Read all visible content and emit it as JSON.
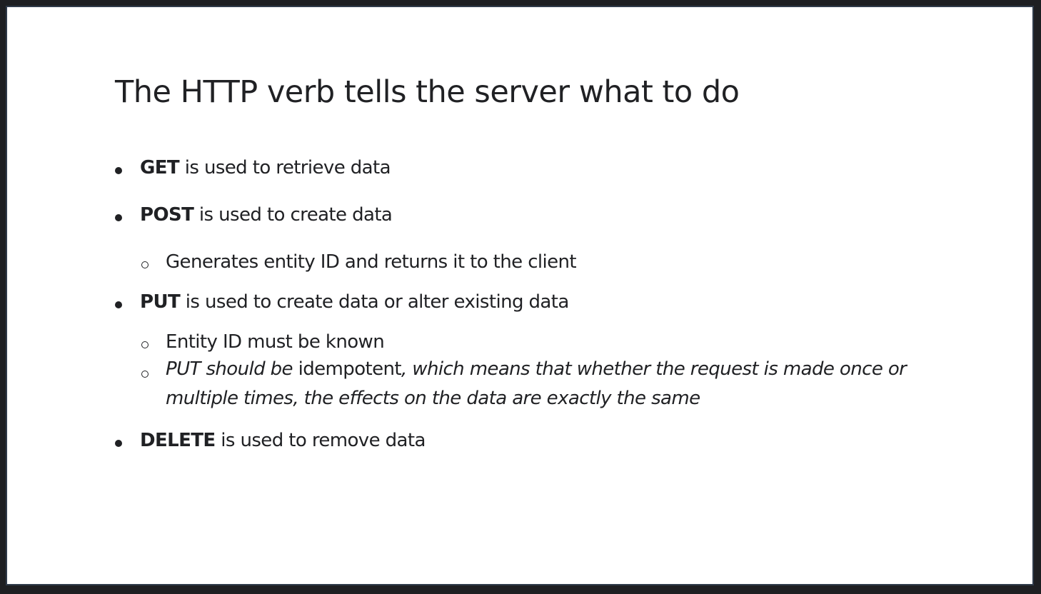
{
  "slide": {
    "title": "The HTTP verb tells the server what to do",
    "bullets": {
      "get": {
        "verb": "GET",
        "text": " is used to retrieve data"
      },
      "post": {
        "verb": "POST",
        "text": " is used to create data",
        "sub": "Generates entity ID and returns it to the client"
      },
      "put": {
        "verb": "PUT",
        "text": " is used to create data or alter existing data",
        "sub1": "Entity ID must be known",
        "sub2_italic_a": "PUT should be",
        "sub2_plain": " idempotent",
        "sub2_italic_b": ", which means that whether the request is made once or multiple times, the effects on the data are exactly the same"
      },
      "delete": {
        "verb": "DELETE",
        "text": " is used to remove data"
      }
    }
  }
}
